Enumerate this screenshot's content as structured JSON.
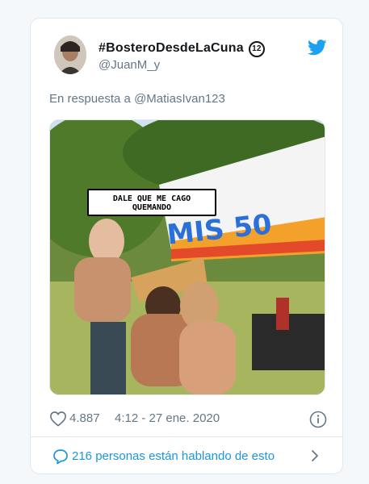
{
  "tweet": {
    "display_name": "#BosteroDesdeLaCuna",
    "badge": "12",
    "handle": "@JuanM_y",
    "reply_to": "En respuesta a @MatiasIvan123",
    "media": {
      "speech_bubble": "DALE QUE ME CAGO\nQUEMANDO",
      "tent_text": "MIS 50"
    },
    "likes": "4.887",
    "timestamp": "4:12 - 27 ene. 2020",
    "conversation": "216 personas están hablando de esto"
  },
  "colors": {
    "twitter_blue": "#1da1f2",
    "link_blue": "#1b95e0",
    "muted_text": "#657786"
  },
  "icons": [
    "twitter-logo-icon",
    "heart-icon",
    "info-icon",
    "chat-bubble-icon",
    "chevron-right-icon"
  ]
}
